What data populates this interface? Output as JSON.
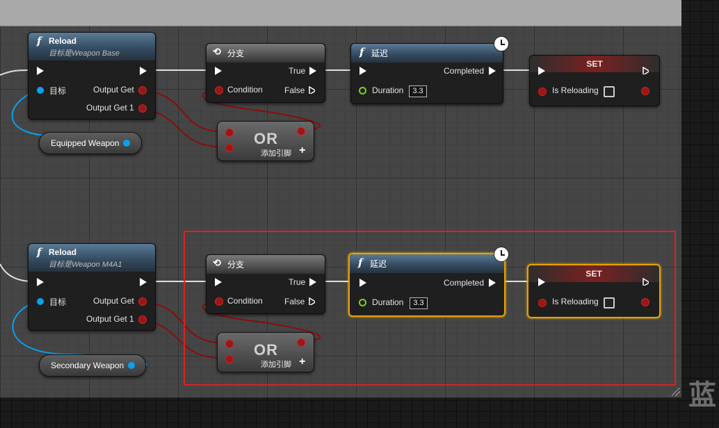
{
  "graph": {
    "right_panel_glyph": "蓝",
    "section_top": {
      "reload_node": {
        "title": "Reload",
        "subtitle": "目标是Weapon Base",
        "pin_target": "目标",
        "pin_output_get": "Output Get",
        "pin_output_get1": "Output Get 1"
      },
      "branch_node": {
        "title": "分支",
        "pin_condition": "Condition",
        "pin_true": "True",
        "pin_false": "False"
      },
      "delay_node": {
        "title": "延迟",
        "pin_completed": "Completed",
        "pin_duration": "Duration",
        "duration_value": "3.3"
      },
      "set_node": {
        "title": "SET",
        "pin_is_reloading": "Is Reloading"
      },
      "or_node": {
        "title": "OR",
        "add_pin_label": "添加引脚"
      },
      "var_node": {
        "label": "Equipped Weapon"
      }
    },
    "section_bottom": {
      "reload_node": {
        "title": "Reload",
        "subtitle": "目标是Weapon M4A1",
        "pin_target": "目标",
        "pin_output_get": "Output Get",
        "pin_output_get1": "Output Get 1"
      },
      "branch_node": {
        "title": "分支",
        "pin_condition": "Condition",
        "pin_true": "True",
        "pin_false": "False"
      },
      "delay_node": {
        "title": "延迟",
        "pin_completed": "Completed",
        "pin_duration": "Duration",
        "duration_value": "3.3"
      },
      "set_node": {
        "title": "SET",
        "pin_is_reloading": "Is Reloading"
      },
      "or_node": {
        "title": "OR",
        "add_pin_label": "添加引脚"
      },
      "var_node": {
        "label": "Secondary Weapon"
      }
    }
  },
  "colors": {
    "exec_wire": "#e0e0e0",
    "bool_wire": "#8b0d0d",
    "object_wire": "#0aa0f0",
    "selection": "#e02020",
    "selected_node": "#e8a000"
  }
}
